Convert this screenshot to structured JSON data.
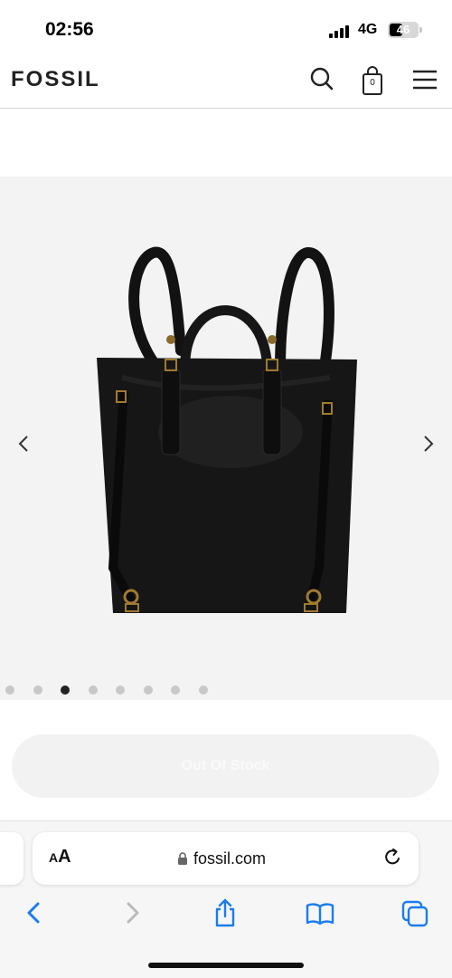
{
  "status_bar": {
    "time": "02:56",
    "network": "4G",
    "battery": "46"
  },
  "header": {
    "brand": "FOSSIL",
    "bag_count": "0",
    "icons": [
      "search-icon",
      "shopping-bag-icon",
      "hamburger-menu-icon"
    ]
  },
  "product": {
    "image": "black leather backpack tote",
    "carousel_total": 8,
    "carousel_active": 3,
    "prev_icon": "chevron-left-icon",
    "next_icon": "chevron-right-icon"
  },
  "cta": {
    "label": "Out Of Stock",
    "state": "disabled"
  },
  "browser": {
    "text_size_label_small": "A",
    "text_size_label_large": "A",
    "url": "fossil.com",
    "icons": [
      "lock-icon",
      "reload-icon",
      "back-icon",
      "forward-icon",
      "share-icon",
      "bookmarks-icon",
      "tabs-icon"
    ]
  },
  "colors": {
    "accent": "#1a7cf0",
    "brand_text": "#222222",
    "image_bg": "#f3f3f3"
  }
}
